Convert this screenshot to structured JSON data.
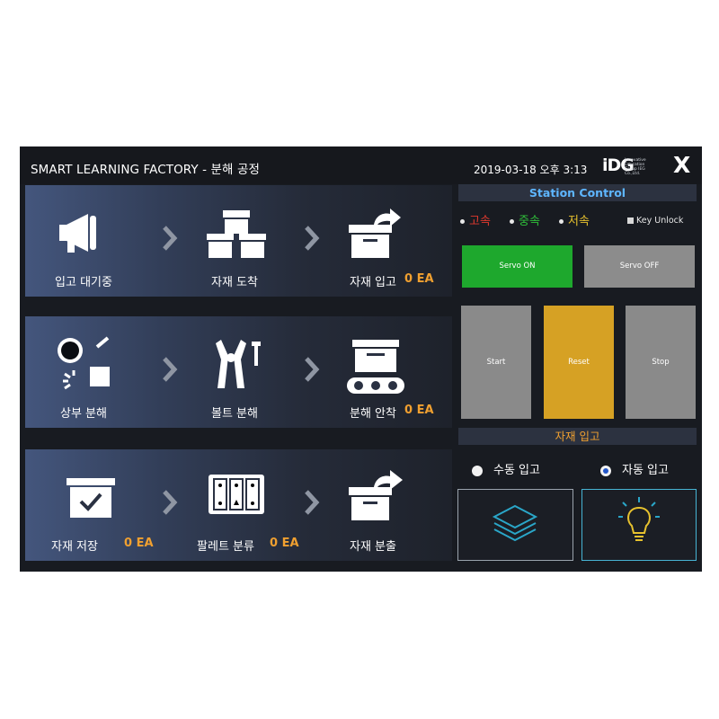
{
  "header": {
    "title": "SMART LEARNING FACTORY - 분해 공정",
    "datetime": "2019-03-18 오후 3:13",
    "logo": {
      "mark": "iDG",
      "tagline": "Innovative Education Group IEG Co.,Ltd."
    },
    "close": "X"
  },
  "rows": [
    {
      "steps": [
        {
          "icon": "megaphone-icon",
          "label": "입고 대기중"
        },
        {
          "icon": "boxes-icon",
          "label": "자재 도착"
        },
        {
          "icon": "box-arrow-icon",
          "label": "자재 입고",
          "qty": "0 EA"
        }
      ]
    },
    {
      "steps": [
        {
          "icon": "disassemble-icon",
          "label": "상부 분해"
        },
        {
          "icon": "pliers-icon",
          "label": "볼트 분해"
        },
        {
          "icon": "conveyor-icon",
          "label": "분해 안착",
          "qty": "0 EA"
        }
      ]
    },
    {
      "steps": [
        {
          "icon": "check-box-icon",
          "label": "자재 저장",
          "qty": "0 EA"
        },
        {
          "icon": "pallet-icon",
          "label": "팔레트 분류",
          "qty": "0 EA"
        },
        {
          "icon": "box-export-icon",
          "label": "자재 분출"
        }
      ]
    }
  ],
  "station": {
    "title": "Station Control",
    "speeds": [
      {
        "label": "고속",
        "color": "#e0392e"
      },
      {
        "label": "중속",
        "color": "#2fbf3a"
      },
      {
        "label": "저속",
        "color": "#e6c12e"
      }
    ],
    "key_unlock": "Key Unlock",
    "servo_on": "Servo ON",
    "servo_off": "Servo OFF",
    "start": "Start",
    "reset": "Reset",
    "stop": "Stop"
  },
  "material": {
    "title": "자재 입고",
    "manual": "수동 입고",
    "auto": "자동 입고",
    "selected": "auto"
  },
  "colors": {
    "qty": "#f0a030",
    "station_title": "#5eb6ff",
    "servo_on": "#1ea82d",
    "reset": "#d6a124"
  }
}
